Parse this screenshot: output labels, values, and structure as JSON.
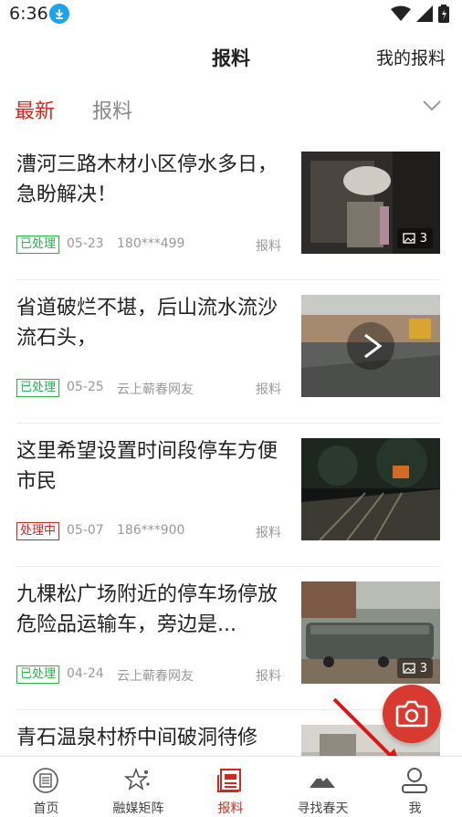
{
  "status_bar": {
    "time": "6:36"
  },
  "header": {
    "title": "报料",
    "my_reports": "我的报料"
  },
  "tabs": [
    {
      "label": "最新",
      "active": true
    },
    {
      "label": "报料",
      "active": false
    }
  ],
  "items": [
    {
      "title": "漕河三路木材小区停水多日，急盼解决！",
      "status": "已处理",
      "status_type": "done",
      "date": "05-23",
      "user": "180***499",
      "category": "报料",
      "image_count": "3",
      "media": "photos"
    },
    {
      "title": "省道破烂不堪，后山流水流沙流石头，",
      "status": "已处理",
      "status_type": "done",
      "date": "05-25",
      "user": "云上蕲春网友",
      "category": "报料",
      "media": "video"
    },
    {
      "title": "这里希望设置时间段停车方便市民",
      "status": "处理中",
      "status_type": "pending",
      "date": "05-07",
      "user": "186***900",
      "category": "报料",
      "media": "photo"
    },
    {
      "title": "九棵松广场附近的停车场停放危险品运输车，旁边是...",
      "status": "已处理",
      "status_type": "done",
      "date": "04-24",
      "user": "云上蕲春网友",
      "category": "报料",
      "image_count": "3",
      "media": "photos"
    },
    {
      "title": "青石温泉村桥中间破洞待修",
      "media": "photo"
    }
  ],
  "bottom_nav": [
    {
      "label": "首页",
      "icon": "home-icon"
    },
    {
      "label": "融媒矩阵",
      "icon": "matrix-icon"
    },
    {
      "label": "报料",
      "icon": "report-icon",
      "active": true
    },
    {
      "label": "寻找春天",
      "icon": "mountain-icon"
    },
    {
      "label": "我",
      "icon": "user-icon"
    }
  ],
  "colors": {
    "accent": "#d0281f",
    "done": "#2bb24c",
    "fab": "#d93a2f"
  }
}
